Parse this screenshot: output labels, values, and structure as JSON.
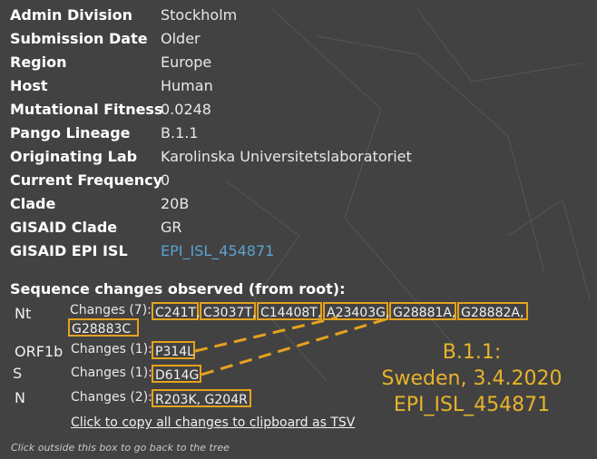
{
  "info": {
    "rows": [
      {
        "key": "Admin Division",
        "value": "Stockholm"
      },
      {
        "key": "Submission Date",
        "value": "Older"
      },
      {
        "key": "Region",
        "value": "Europe"
      },
      {
        "key": "Host",
        "value": "Human"
      },
      {
        "key": "Mutational Fitness",
        "value": "0.0248"
      },
      {
        "key": "Pango Lineage",
        "value": "B.1.1"
      },
      {
        "key": "Originating Lab",
        "value": "Karolinska Universitetslaboratoriet"
      },
      {
        "key": "Current Frequency",
        "value": "0"
      },
      {
        "key": "Clade",
        "value": "20B"
      },
      {
        "key": "GISAID Clade",
        "value": "GR"
      },
      {
        "key": "GISAID EPI ISL",
        "value": "EPI_ISL_454871"
      }
    ]
  },
  "sequence": {
    "title": "Sequence changes observed (from root):",
    "genes": [
      {
        "name": "Nt",
        "label": "Changes (7):",
        "mutations": [
          "C241T,",
          "C3037T,",
          "C14408T,",
          "A23403G,",
          "G28881A,",
          "G28882A,",
          "G28883C"
        ]
      },
      {
        "name": "ORF1b",
        "label": "Changes (1):",
        "mutations": [
          "P314L"
        ]
      },
      {
        "name": "S",
        "label": "Changes (1):",
        "mutations": [
          "D614G"
        ]
      },
      {
        "name": "N",
        "label": "Changes (2):",
        "mutations": [
          "R203K, G204R"
        ]
      }
    ],
    "copy_link": "Click to copy all changes to clipboard as TSV"
  },
  "footer": {
    "hint": "Click outside this box to go back to the tree"
  },
  "annotation": {
    "lines": [
      "B.1.1:",
      "Sweden, 3.4.2020",
      "EPI_ISL_454871"
    ]
  },
  "colors": {
    "background": "#424242",
    "highlight": "#e5a21e",
    "annotation": "#e8b32a",
    "link": "#5aa3d1"
  }
}
